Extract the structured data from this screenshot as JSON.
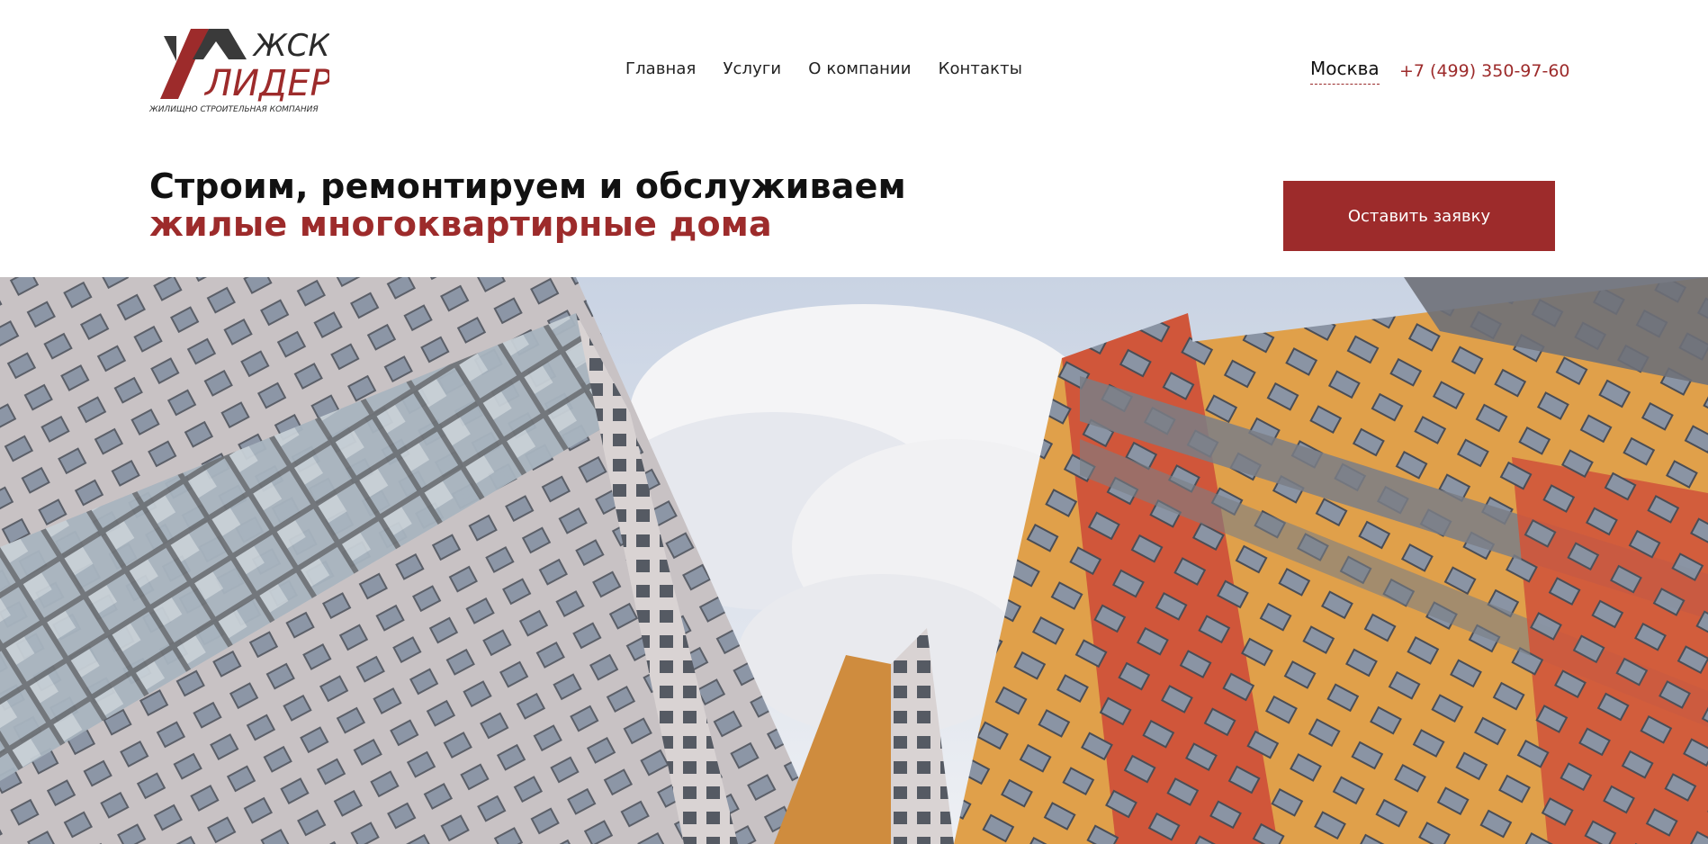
{
  "brand": {
    "logo_line1": "ЖСК",
    "logo_line2": "ЛИДЕР",
    "tagline": "ЖИЛИЩНО СТРОИТЕЛЬНАЯ КОМПАНИЯ"
  },
  "nav": {
    "items": [
      {
        "label": "Главная"
      },
      {
        "label": "Услуги"
      },
      {
        "label": "О компании"
      },
      {
        "label": "Контакты"
      }
    ]
  },
  "contact": {
    "city": "Москва",
    "phone": "+7 (499) 350-97-60"
  },
  "hero": {
    "title_line1": "Строим, ремонтируем и обслуживаем",
    "title_line2": "жилые многоквартирные дома",
    "cta_label": "Оставить заявку"
  },
  "colors": {
    "accent": "#9d2b2b",
    "text": "#111111",
    "background": "#ffffff"
  }
}
